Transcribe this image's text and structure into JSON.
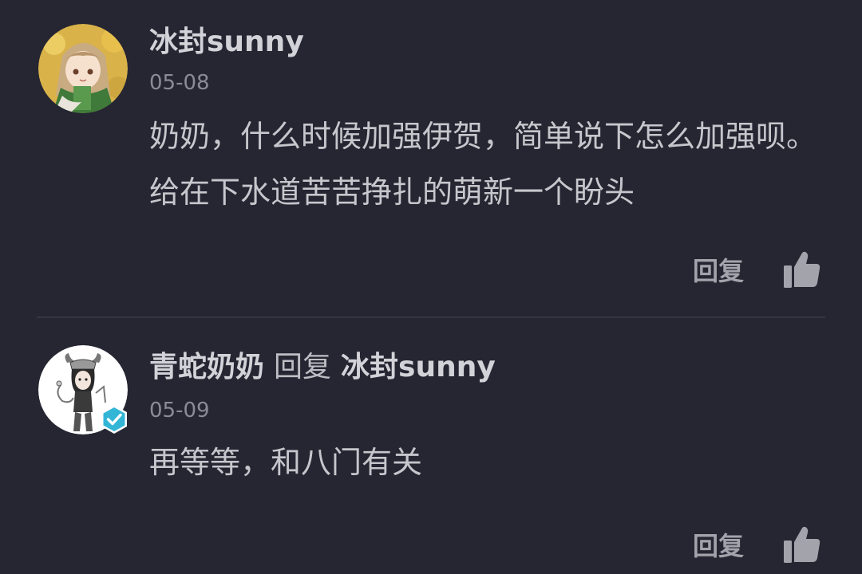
{
  "comments": [
    {
      "author": "冰封sunny",
      "date": "05-08",
      "content": "奶奶，什么时候加强伊贺，简单说下怎么加强呗。给在下水道苦苦挣扎的萌新一个盼头",
      "reply_label": "回复",
      "avatar_icon": "anime-girl-avatar",
      "like_icon": "thumbs-up-icon"
    },
    {
      "author": "青蛇奶奶",
      "reply_word": "回复",
      "reply_to": "冰封sunny",
      "date": "05-09",
      "content": "再等等，和八门有关",
      "reply_label": "回复",
      "avatar_icon": "horned-character-avatar",
      "verified_icon": "verified-badge-icon",
      "like_icon": "thumbs-up-icon"
    }
  ],
  "colors": {
    "background": "#252632",
    "verified_badge": "#33b6d6"
  }
}
